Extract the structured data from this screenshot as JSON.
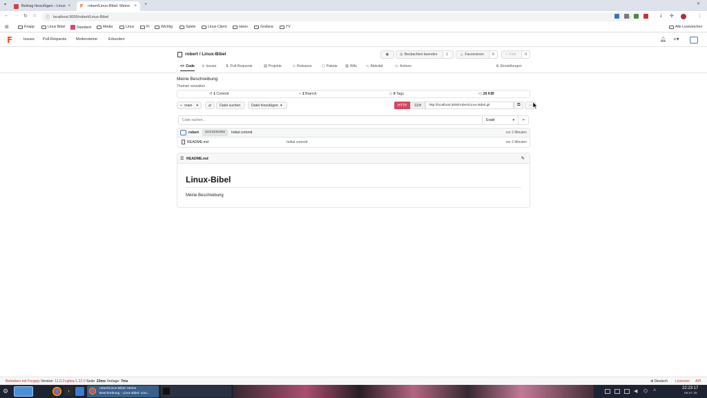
{
  "browser": {
    "tabs": [
      {
        "title": "Beitrag hinzufügen ‹ Linux",
        "active": false
      },
      {
        "title": "robert/Linux-Bibel: Meine",
        "active": true
      }
    ],
    "url": "localhost:3000/robert/Linux-Bibel",
    "bookmarks": [
      "Knapp",
      "Linux Bibel",
      "Standard",
      "Media",
      "Linux",
      "Pi",
      "Wichtig",
      "Spiele",
      "Linux-Client",
      "Ideen",
      "Grafana",
      "TV"
    ],
    "all_bookmarks": "Alle Lesezeichen"
  },
  "navbar": {
    "links": [
      "Issues",
      "Pull-Requests",
      "Meilensteine",
      "Erkunden"
    ]
  },
  "repo": {
    "owner_repo": "robert / Linux-Bibel",
    "watch_label": "Beobachten beenden",
    "watch_count": "1",
    "star_label": "Favorisieren",
    "star_count": "0",
    "fork_label": "Fork",
    "fork_count": "0",
    "tabs": [
      "Code",
      "Issues",
      "Pull-Requests",
      "Projekte",
      "Releases",
      "Pakete",
      "Wiki",
      "Aktivität",
      "Actions"
    ],
    "settings": "Einstellungen",
    "description": "Meine Beschreibung",
    "topics": "Themen verwalten",
    "stats": {
      "commits": "1",
      "commits_label": "Commit",
      "branches": "1",
      "branches_label": "Branch",
      "tags": "0",
      "tags_label": "Tags",
      "size": "28 KiB"
    },
    "branch": "main",
    "search_file": "Datei suchen",
    "add_file": "Datei hinzufügen",
    "clone": {
      "http": "HTTP",
      "ssh": "SSH",
      "url": "http://localhost:3000/robert/Linux-Bibel.git"
    },
    "code_search_placeholder": "Code suchen…",
    "search_mode": "Exakt",
    "latest_commit": {
      "author": "robert",
      "sha": "1e11341e63",
      "message": "Initial commit",
      "time": "vor 2 Minuten"
    },
    "files": [
      {
        "name": "README.md",
        "message": "Initial commit",
        "time": "vor 2 Minuten"
      }
    ],
    "readme": {
      "filename": "README.md",
      "title": "Linux-Bibel",
      "body": "Meine Beschreibung"
    }
  },
  "footer": {
    "powered": "Betrieben mit Forgejo",
    "version_label": "Version:",
    "version": "11.0.2+gitea-1.22.0",
    "page_label": "Seite:",
    "page_time": "23ms",
    "template_label": "Vorlage:",
    "template_time": "7ms",
    "language": "Deutsch",
    "licenses": "Lizenzen",
    "api": "API"
  },
  "taskbar": {
    "window_title_line1": "robert/Linux-Bibel: Meine",
    "window_title_line2": "Beschreibung - Linux Bibel: Linu...",
    "time": "22:23:17",
    "date": "06.07.25"
  },
  "colors": {
    "forgejo_orange": "#e8551e",
    "http_active": "#d9455f",
    "link_red": "#c0392b"
  }
}
